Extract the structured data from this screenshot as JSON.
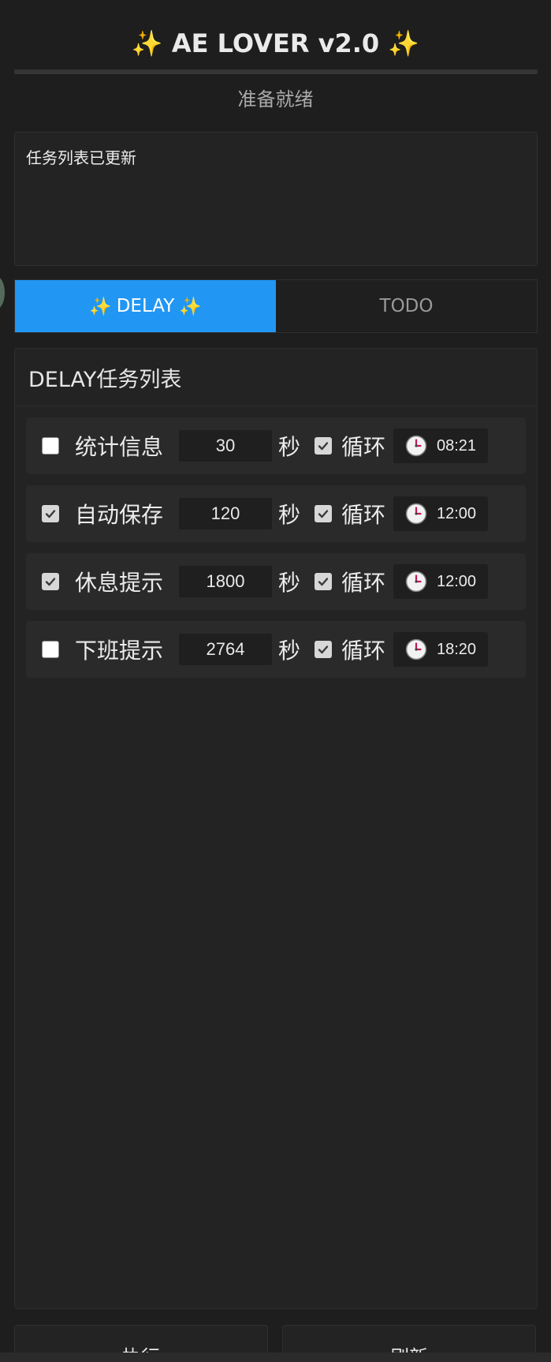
{
  "header": {
    "spark_left": "✨",
    "title": "AE LOVER v2.0",
    "spark_right": "✨"
  },
  "status": "准备就绪",
  "log": "任务列表已更新",
  "tabs": [
    {
      "spark_left": "✨",
      "label": "DELAY",
      "spark_right": "✨"
    },
    {
      "label": "TODO"
    }
  ],
  "panel": {
    "title": "DELAY任务列表",
    "unit": "秒",
    "loop_label": "循环",
    "tasks": [
      {
        "name": "统计信息",
        "enabled": false,
        "seconds": "30",
        "loop": true,
        "time": "08:21"
      },
      {
        "name": "自动保存",
        "enabled": true,
        "seconds": "120",
        "loop": true,
        "time": "12:00"
      },
      {
        "name": "休息提示",
        "enabled": true,
        "seconds": "1800",
        "loop": true,
        "time": "12:00"
      },
      {
        "name": "下班提示",
        "enabled": false,
        "seconds": "2764",
        "loop": true,
        "time": "18:20"
      }
    ]
  },
  "buttons": {
    "execute": "执行",
    "refresh": "刷新"
  },
  "colors": {
    "accent": "#2196f3",
    "background": "#1e1e1e",
    "spark": "#f4c542"
  }
}
